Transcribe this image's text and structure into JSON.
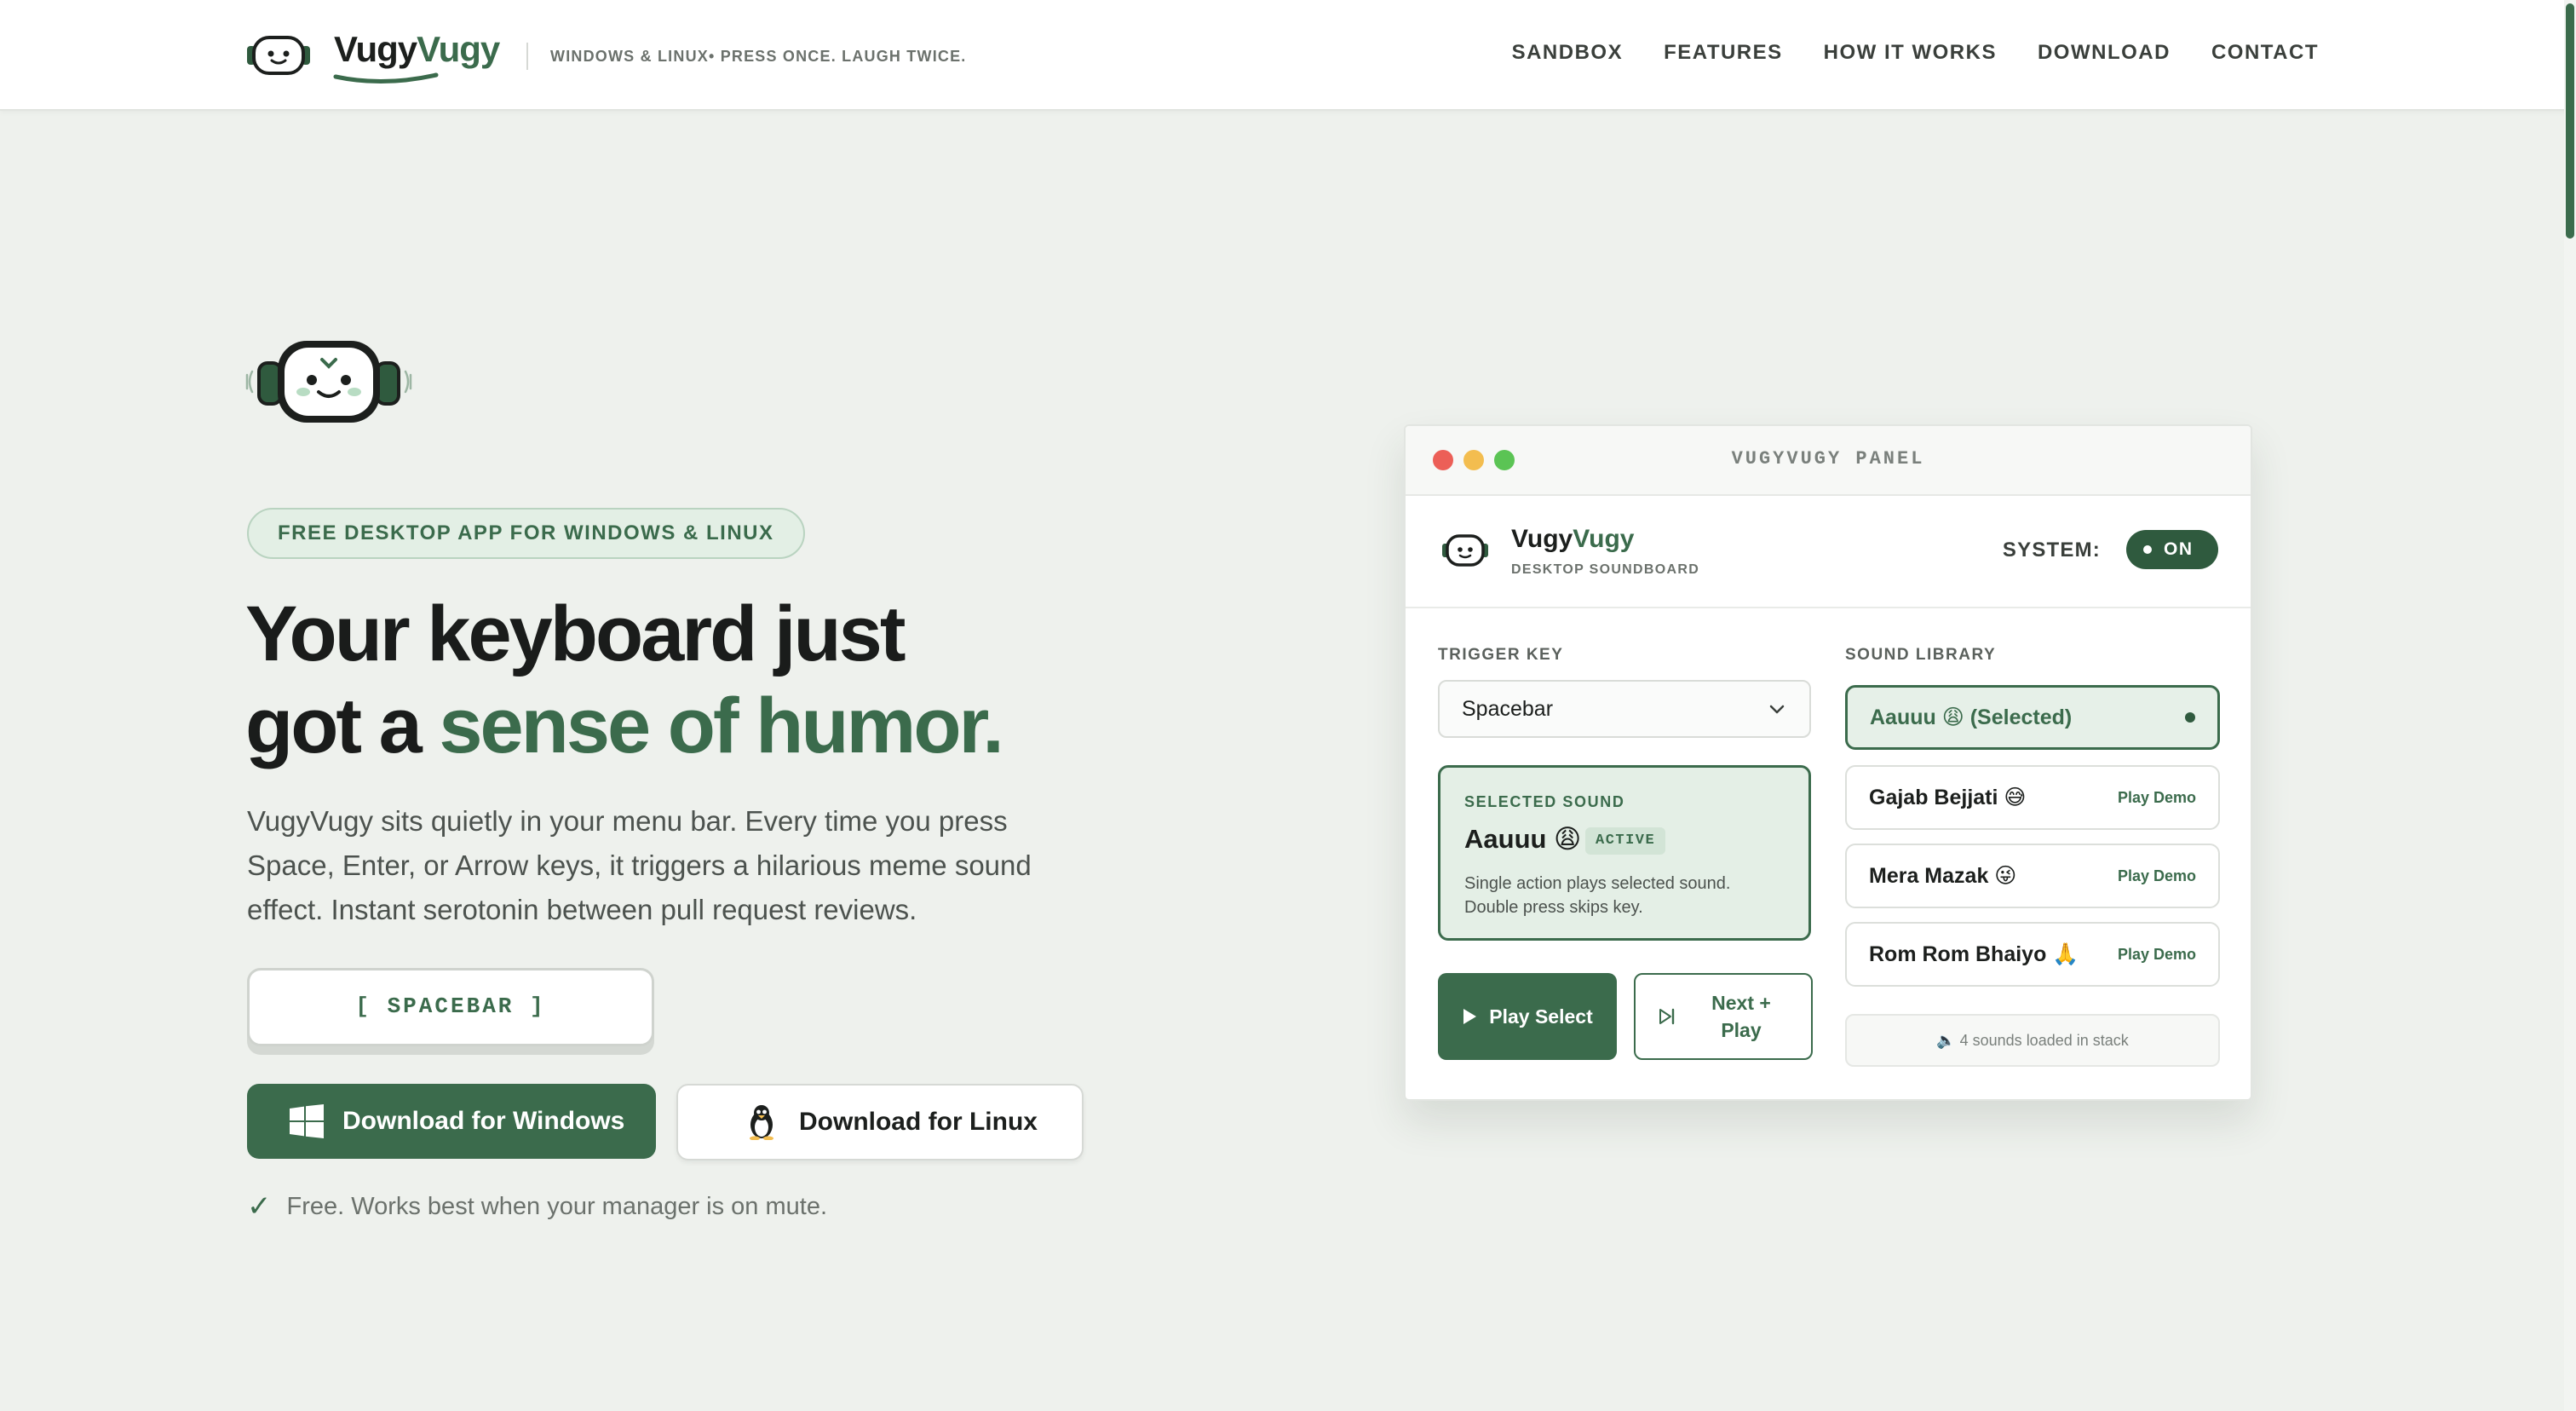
{
  "header": {
    "brand_part1": "Vugy",
    "brand_part2": "Vugy",
    "tagline": "WINDOWS & LINUX• PRESS ONCE. LAUGH TWICE.",
    "nav": [
      "SANDBOX",
      "FEATURES",
      "HOW IT WORKS",
      "DOWNLOAD",
      "CONTACT"
    ]
  },
  "hero": {
    "pill": "FREE DESKTOP APP FOR WINDOWS & LINUX",
    "headline_line1": "Your keyboard just",
    "headline_line2_plain": "got a ",
    "headline_line2_accent": "sense of humor.",
    "lede": "VugyVugy sits quietly in your menu bar. Every time you press Space, Enter, or Arrow keys, it triggers a hilarious meme sound effect. Instant serotonin between pull request reviews.",
    "keycap": "[ SPACEBAR ]",
    "download_windows": "Download for Windows",
    "download_linux": "Download for Linux",
    "note": "Free. Works best when your manager is on mute."
  },
  "panel": {
    "title": "VUGYVUGY PANEL",
    "app_name_part1": "Vugy",
    "app_name_part2": "Vugy",
    "app_subtitle": "DESKTOP SOUNDBOARD",
    "system_label": "SYSTEM:",
    "system_state": "ON",
    "trigger_key_label": "TRIGGER KEY",
    "trigger_key_value": "Spacebar",
    "selected_sound_label": "SELECTED SOUND",
    "selected_sound_name": "Aauuu 😩",
    "selected_sound_badge": "ACTIVE",
    "selected_sound_desc": "Single action plays selected sound. Double press skips key.",
    "play_select": "Play Select",
    "next_play": "Next + Play",
    "sound_library_label": "SOUND LIBRARY",
    "sounds": [
      {
        "name": "Aauuu 😩 (Selected)",
        "action": ""
      },
      {
        "name": "Gajab Bejjati 😅",
        "action": "Play Demo"
      },
      {
        "name": "Mera Mazak 😜",
        "action": "Play Demo"
      },
      {
        "name": "Rom Rom Bhaiyo 🙏",
        "action": "Play Demo"
      }
    ],
    "stack_note": "🔈 4 sounds loaded in stack"
  },
  "colors": {
    "accent": "#3b6b4c",
    "accent_dark": "#2f5a3e",
    "background": "#eef1ed"
  }
}
